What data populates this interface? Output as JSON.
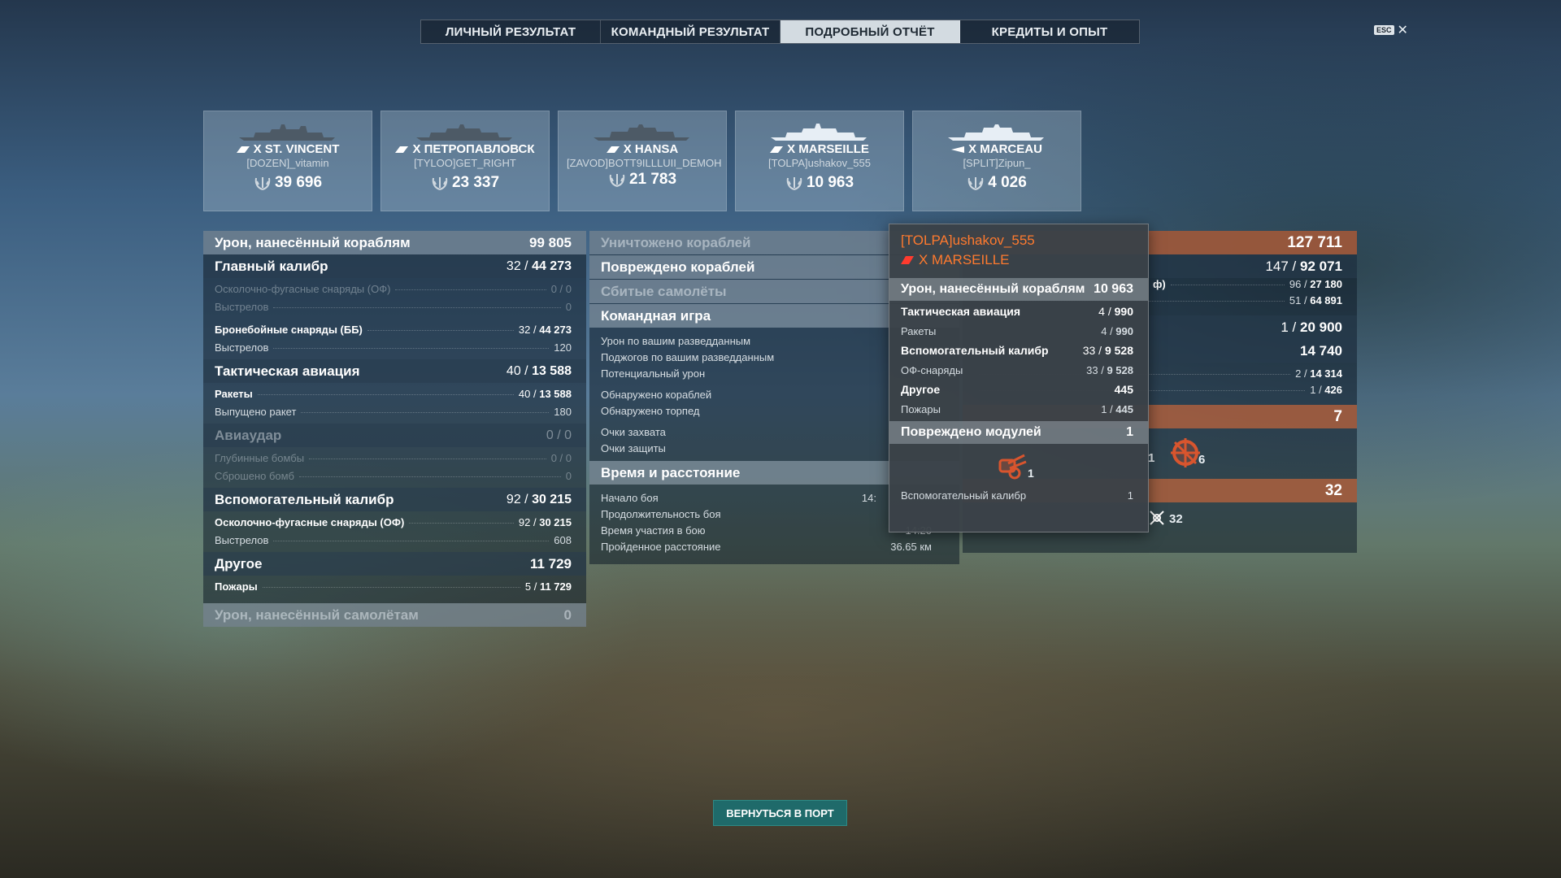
{
  "tabs": [
    {
      "label": "ЛИЧНЫЙ РЕЗУЛЬТАТ",
      "active": false
    },
    {
      "label": "КОМАНДНЫЙ РЕЗУЛЬТАТ",
      "active": false
    },
    {
      "label": "ПОДРОБНЫЙ ОТЧЁТ",
      "active": true
    },
    {
      "label": "КРЕДИТЫ И ОПЫТ",
      "active": false
    }
  ],
  "esc": {
    "key": "ESC",
    "close": "✕"
  },
  "ships": [
    {
      "name": "X ST. VINCENT",
      "player": "[DOZEN]_vitamin",
      "score": "39 696",
      "color": "#4d5a66"
    },
    {
      "name": "X ПЕТРОПАВЛОВСК",
      "player": "[TYLOO]GET_RIGHT",
      "score": "23 337",
      "color": "#4d5a66"
    },
    {
      "name": "X HANSA",
      "player": "[ZAVOD]BOTT9ILLLUII_DEMOH",
      "score": "21 783",
      "color": "#4d5a66"
    },
    {
      "name": "X MARSEILLE",
      "player": "[TOLPA]ushakov_555",
      "score": "10 963",
      "color": "#e7eef5"
    },
    {
      "name": "X MARCEAU",
      "player": "[SPLIT]Zipun_",
      "score": "4 026",
      "color": "#e7eef5"
    }
  ],
  "left": {
    "header": {
      "label": "Урон, нанесённый кораблям",
      "value": "99 805"
    },
    "main_caliber": {
      "label": "Главный калибр",
      "value_a": "32",
      "value_b": "44 273"
    },
    "he": {
      "label": "Осколочно-фугасные снаряды (ОФ)",
      "value": "0 / 0"
    },
    "he_shots": {
      "label": "Выстрелов",
      "value": "0"
    },
    "ap": {
      "label": "Бронебойные снаряды (ББ)",
      "value_a": "32",
      "value_b": "44 273"
    },
    "ap_shots": {
      "label": "Выстрелов",
      "value": "120"
    },
    "tac_air": {
      "label": "Тактическая авиация",
      "value_a": "40",
      "value_b": "13 588"
    },
    "rockets": {
      "label": "Ракеты",
      "value_a": "40",
      "value_b": "13 588"
    },
    "rockets_fired": {
      "label": "Выпущено ракет",
      "value": "180"
    },
    "airstrike": {
      "label": "Авиаудар",
      "value": "0 / 0"
    },
    "depth": {
      "label": "Глубинные бомбы",
      "value": "0 / 0"
    },
    "bombs": {
      "label": "Сброшено бомб",
      "value": "0"
    },
    "secondary": {
      "label": "Вспомогательный калибр",
      "value_a": "92",
      "value_b": "30 215"
    },
    "sec_he": {
      "label": "Осколочно-фугасные снаряды (ОФ)",
      "value_a": "92",
      "value_b": "30 215"
    },
    "sec_shots": {
      "label": "Выстрелов",
      "value": "608"
    },
    "other": {
      "label": "Другое",
      "value": "11 729"
    },
    "fires": {
      "label": "Пожары",
      "value_a": "5",
      "value_b": "11 729"
    },
    "planes": {
      "label": "Урон, нанесённый самолётам",
      "value": "0"
    }
  },
  "middle": {
    "destroyed": "Уничтожено кораблей",
    "damaged": "Повреждено кораблей",
    "shot_planes": "Сбитые самолёты",
    "team_play": "Командная игра",
    "team_rows": [
      "Урон по вашим разведданным",
      "Поджогов по вашим разведданным",
      "Потенциальный урон"
    ],
    "spot_rows": [
      "Обнаружено кораблей",
      "Обнаружено торпед"
    ],
    "cap_rows": [
      "Очки захвата",
      "Очки защиты"
    ],
    "time_header": "Время и расстояние",
    "time_rows": [
      {
        "label": "Начало боя",
        "value": "14:"
      },
      {
        "label": "Продолжительность боя",
        "value": ""
      },
      {
        "label": "Время участия в бою",
        "value": "14:20"
      },
      {
        "label": "Пройденное расстояние",
        "value": "36.65 км"
      }
    ]
  },
  "right": {
    "header_value": "127 711",
    "r1": {
      "a": "147",
      "b": "92 071"
    },
    "r2_label": "ф)",
    "r2": {
      "a": "96",
      "b": "27 180"
    },
    "r3": {
      "a": "51",
      "b": "64 891"
    },
    "r4": {
      "a": "1",
      "b": "20 900"
    },
    "r5": "14 740",
    "r6": {
      "a": "2",
      "b": "14 314"
    },
    "r7": {
      "a": "1",
      "b": "426"
    },
    "modules_value": "7",
    "icon_count_a": "1",
    "icon_count_b": "6",
    "fires_value": "32",
    "fires_icon_count": "32"
  },
  "tooltip": {
    "player": "[TOLPA]ushakov_555",
    "ship": "X MARSEILLE",
    "header": {
      "label": "Урон, нанесённый кораблям",
      "value": "10 963"
    },
    "tac_air": {
      "label": "Тактическая авиация",
      "value_a": "4",
      "value_b": "990"
    },
    "rockets": {
      "label": "Ракеты",
      "value_a": "4",
      "value_b": "990"
    },
    "secondary": {
      "label": "Вспомогательный калибр",
      "value_a": "33",
      "value_b": "9 528"
    },
    "he_shells": {
      "label": "ОФ-снаряды",
      "value_a": "33",
      "value_b": "9 528"
    },
    "other": {
      "label": "Другое",
      "value": "445"
    },
    "fires": {
      "label": "Пожары",
      "value_a": "1",
      "value_b": "445"
    },
    "modules": {
      "label": "Повреждено модулей",
      "value": "1"
    },
    "module_icon_count": "1",
    "module_row": {
      "label": "Вспомогательный калибр",
      "value": "1"
    }
  },
  "back_button": "ВЕРНУТЬСЯ В ПОРТ",
  "accent": "#ff7a2e"
}
